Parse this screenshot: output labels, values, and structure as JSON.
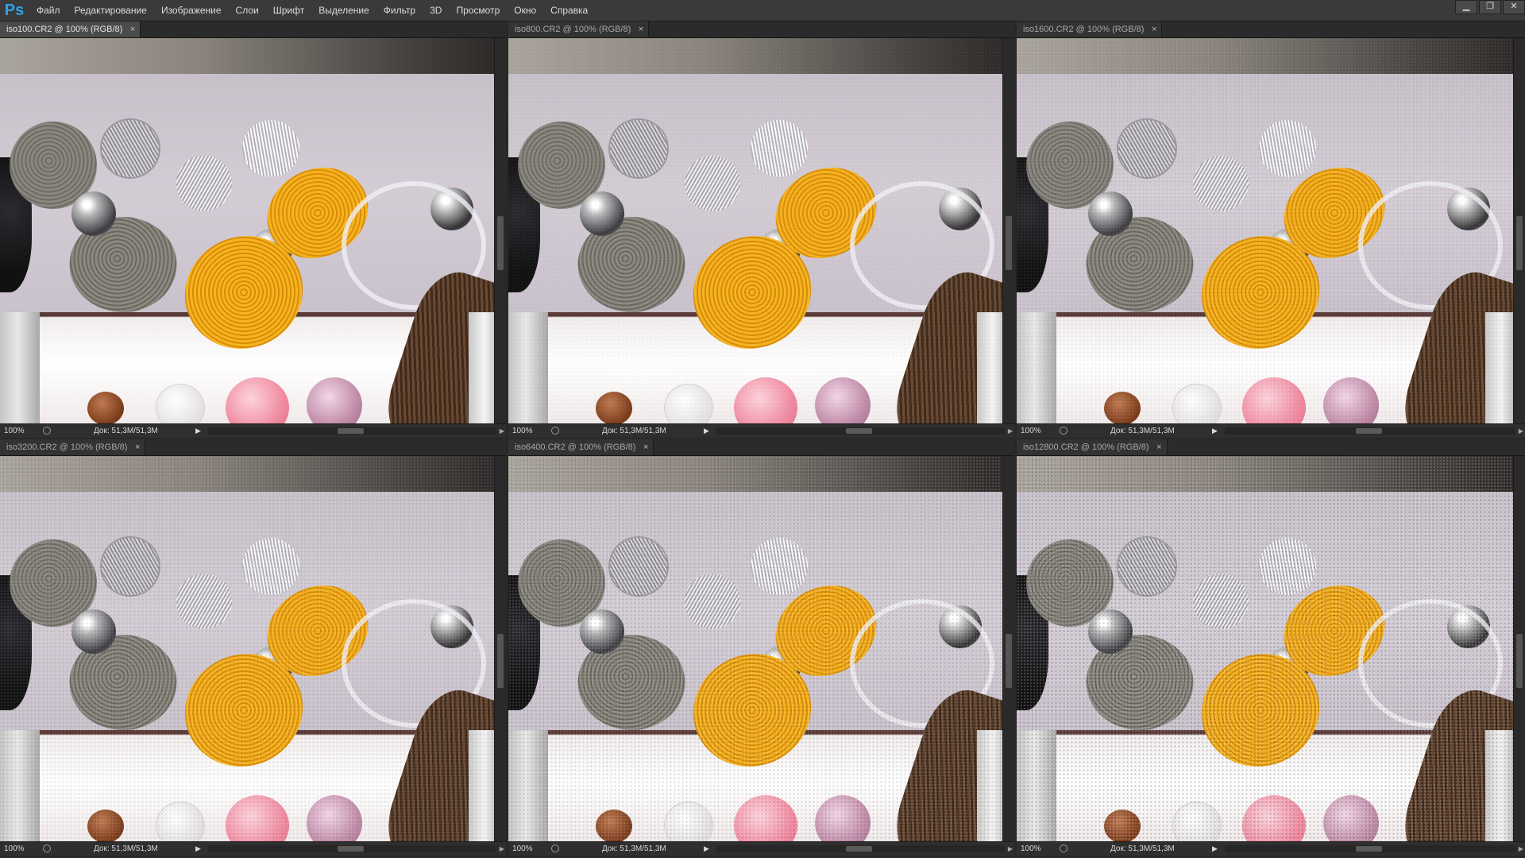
{
  "app": {
    "logo": "Ps",
    "menu": [
      "Файл",
      "Редактирование",
      "Изображение",
      "Слои",
      "Шрифт",
      "Выделение",
      "Фильтр",
      "3D",
      "Просмотр",
      "Окно",
      "Справка"
    ],
    "window_controls": [
      "minimize-icon",
      "restore-icon",
      "close-icon"
    ]
  },
  "documents": [
    {
      "tab": "iso100.CR2 @ 100% (RGB/8)",
      "close": "×",
      "active": true,
      "zoom": "100%",
      "doc_info": "Док: 51,3M/51,3M",
      "noise_level": 0.0
    },
    {
      "tab": "iso800.CR2 @ 100% (RGB/8)",
      "close": "×",
      "active": false,
      "zoom": "100%",
      "doc_info": "Док: 51,3M/51,3M",
      "noise_level": 0.15
    },
    {
      "tab": "iso1600.CR2 @ 100% (RGB/8)",
      "close": "×",
      "active": false,
      "zoom": "100%",
      "doc_info": "Док: 51,3M/51,3M",
      "noise_level": 0.3
    },
    {
      "tab": "iso3200.CR2 @ 100% (RGB/8)",
      "close": "×",
      "active": false,
      "zoom": "100%",
      "doc_info": "Док: 51,3M/51,3M",
      "noise_level": 0.45
    },
    {
      "tab": "iso6400.CR2 @ 100% (RGB/8)",
      "close": "×",
      "active": false,
      "zoom": "100%",
      "doc_info": "Док: 51,3M/51,3M",
      "noise_level": 0.65
    },
    {
      "tab": "iso12800.CR2 @ 100% (RGB/8)",
      "close": "×",
      "active": false,
      "zoom": "100%",
      "doc_info": "Док: 51,3M/51,3M",
      "noise_level": 0.9
    }
  ],
  "colors": {
    "app_bg": "#282828",
    "menubar_bg": "#3a3a3a",
    "logo_blue": "#2fa3e6",
    "thread_yellow": "#f3a91a",
    "thread_gray": "#8a8780",
    "bead_pink": "#f08aa0",
    "bead_mauve": "#c08aa8",
    "bead_brown": "#8a4a2a",
    "hair_brown": "#6b4a32",
    "mat_lilac": "#cfc8d2"
  }
}
